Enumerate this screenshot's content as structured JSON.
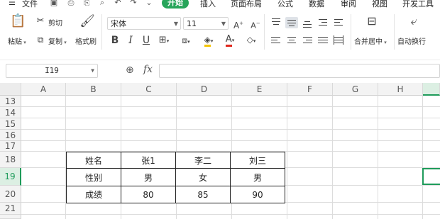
{
  "menubar": {
    "file_label": "文件",
    "tabs": [
      "开始",
      "插入",
      "页面布局",
      "公式",
      "数据",
      "审阅",
      "视图",
      "开发工具"
    ],
    "active_tab": "开始"
  },
  "ribbon": {
    "paste": "粘贴",
    "cut": "剪切",
    "copy": "复制",
    "format_painter": "格式刷",
    "font_name": "宋体",
    "font_size": "11",
    "merge_center": "合并居中",
    "wrap_text": "自动换行"
  },
  "formula_bar": {
    "name_box": "I19",
    "fx_symbol": "fx",
    "formula_value": ""
  },
  "grid": {
    "columns": [
      "A",
      "B",
      "C",
      "D",
      "E",
      "F",
      "G",
      "H"
    ],
    "rows": [
      "13",
      "14",
      "15",
      "16",
      "17",
      "18",
      "19",
      "20",
      "21"
    ],
    "selected_row": "19"
  },
  "table": [
    [
      "姓名",
      "张1",
      "李二",
      "刘三"
    ],
    [
      "性别",
      "男",
      "女",
      "男"
    ],
    [
      "成绩",
      "80",
      "85",
      "90"
    ]
  ],
  "colors": {
    "accent": "#27a55a",
    "selection": "#1e9b5a"
  }
}
